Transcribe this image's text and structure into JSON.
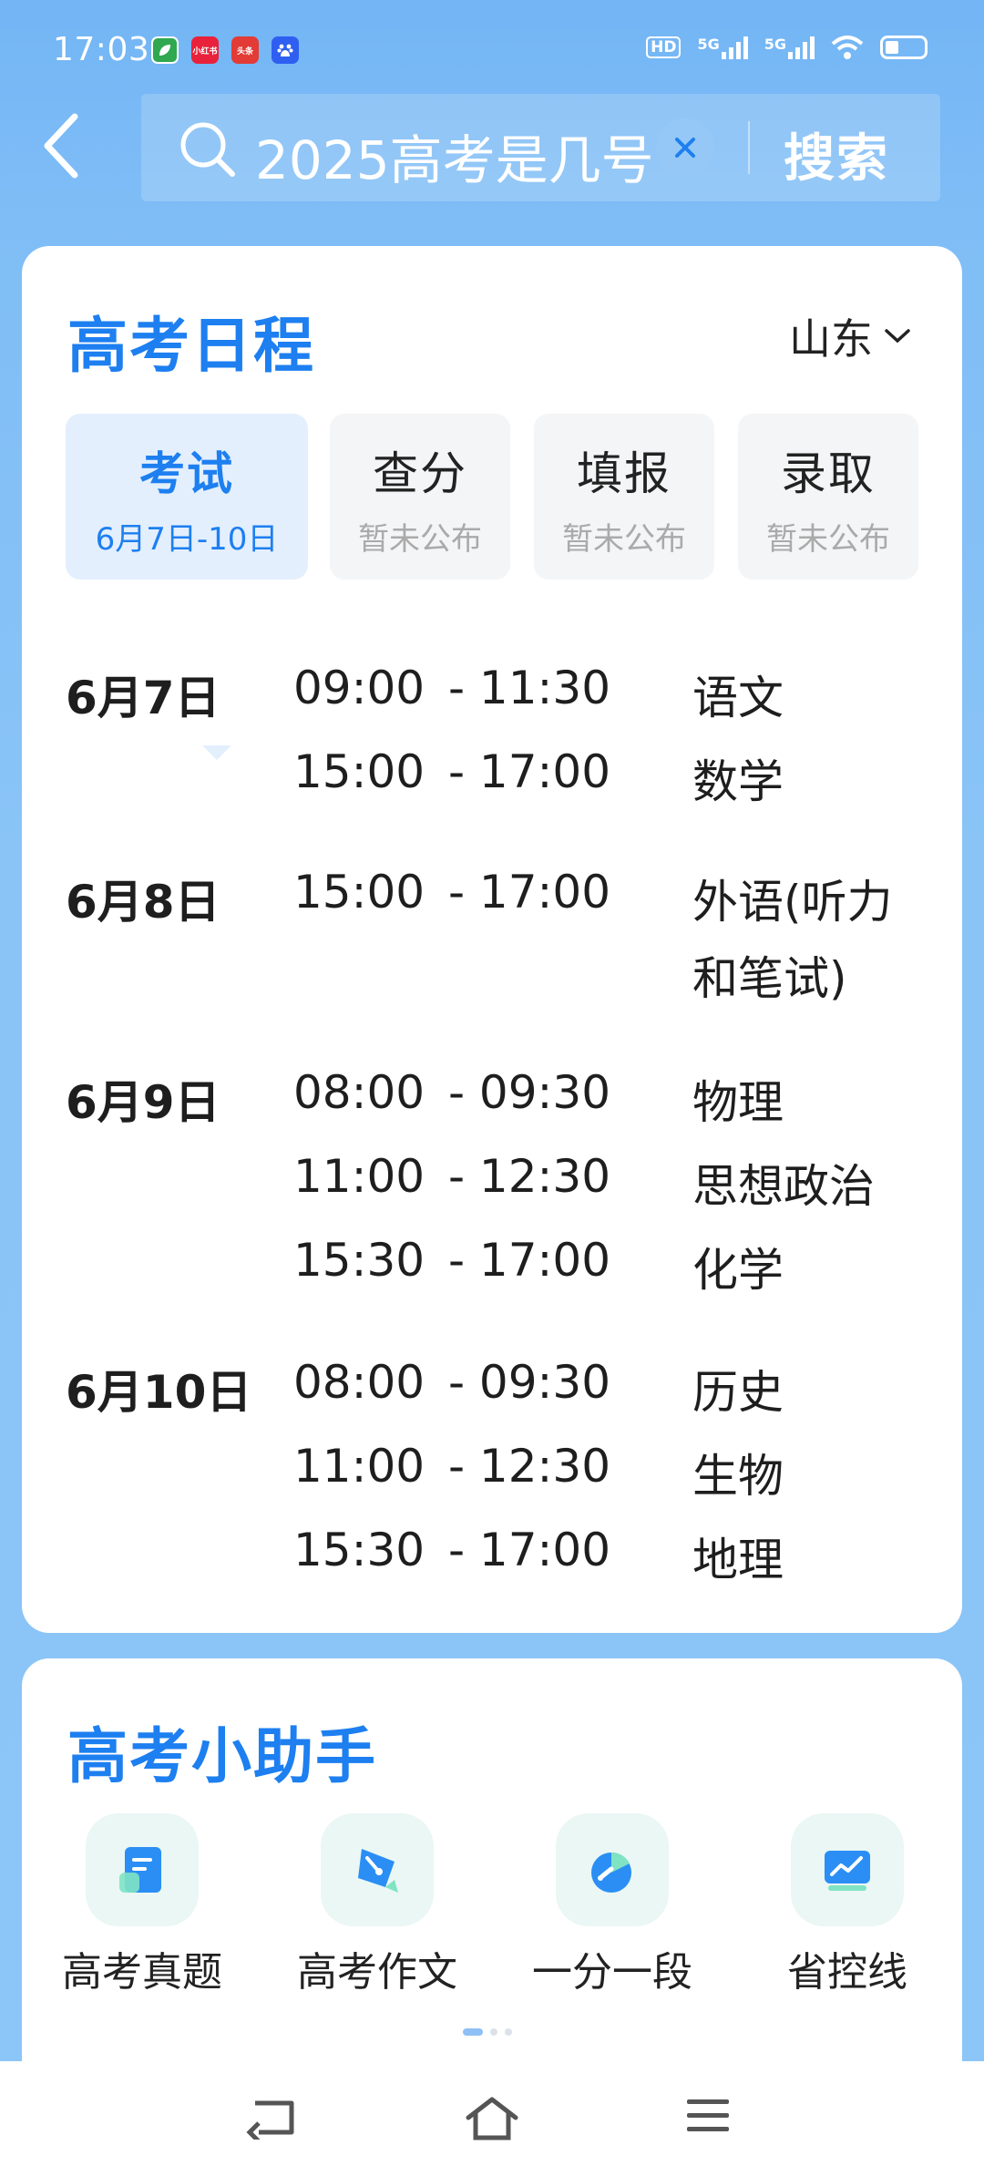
{
  "status_bar": {
    "time": "17:03",
    "apps": [
      {
        "icon": "leaf-app-icon",
        "color": "#2fa84f",
        "text": ""
      },
      {
        "icon": "xiaohongshu-app-icon",
        "color": "#e8223a",
        "text": "小红书"
      },
      {
        "icon": "toutiao-app-icon",
        "color": "#e33b35",
        "text": "头条"
      },
      {
        "icon": "baidu-app-icon",
        "color": "#2f5ff0",
        "text": ""
      }
    ],
    "hd": "HD",
    "net1": "5G",
    "net2": "5G"
  },
  "header": {
    "search_query": "2025高考是几号",
    "search_button": "搜索"
  },
  "schedule": {
    "title": "高考日程",
    "region": "山东",
    "tabs": [
      {
        "label": "考试",
        "sub": "6月7日-10日",
        "active": true
      },
      {
        "label": "查分",
        "sub": "暂未公布",
        "active": false
      },
      {
        "label": "填报",
        "sub": "暂未公布",
        "active": false
      },
      {
        "label": "录取",
        "sub": "暂未公布",
        "active": false
      }
    ],
    "days": [
      {
        "date": "6月7日",
        "sessions": [
          {
            "start": "09:00",
            "end": "- 11:30",
            "subject": "语文"
          },
          {
            "start": "15:00",
            "end": "- 17:00",
            "subject": "数学"
          }
        ]
      },
      {
        "date": "6月8日",
        "sessions": [
          {
            "start": "15:00",
            "end": "- 17:00",
            "subject": "外语(听力",
            "subject2": "和笔试)"
          }
        ]
      },
      {
        "date": "6月9日",
        "sessions": [
          {
            "start": "08:00",
            "end": "- 09:30",
            "subject": "物理"
          },
          {
            "start": "11:00",
            "end": "- 12:30",
            "subject": "思想政治"
          },
          {
            "start": "15:30",
            "end": "- 17:00",
            "subject": "化学"
          }
        ]
      },
      {
        "date": "6月10日",
        "sessions": [
          {
            "start": "08:00",
            "end": "- 09:30",
            "subject": "历史"
          },
          {
            "start": "11:00",
            "end": "- 12:30",
            "subject": "生物"
          },
          {
            "start": "15:30",
            "end": "- 17:00",
            "subject": "地理"
          }
        ]
      }
    ]
  },
  "assistant": {
    "title": "高考小助手",
    "items": [
      {
        "label": "高考真题",
        "icon": "exam-paper-icon"
      },
      {
        "label": "高考作文",
        "icon": "pen-nib-icon"
      },
      {
        "label": "一分一段",
        "icon": "score-chart-icon"
      },
      {
        "label": "省控线",
        "icon": "trend-line-icon"
      }
    ],
    "page_indicator": {
      "current": 1,
      "total": 3
    }
  },
  "colors": {
    "accent": "#1d7ff0",
    "background": "#7fbdf6",
    "card": "#ffffff"
  }
}
